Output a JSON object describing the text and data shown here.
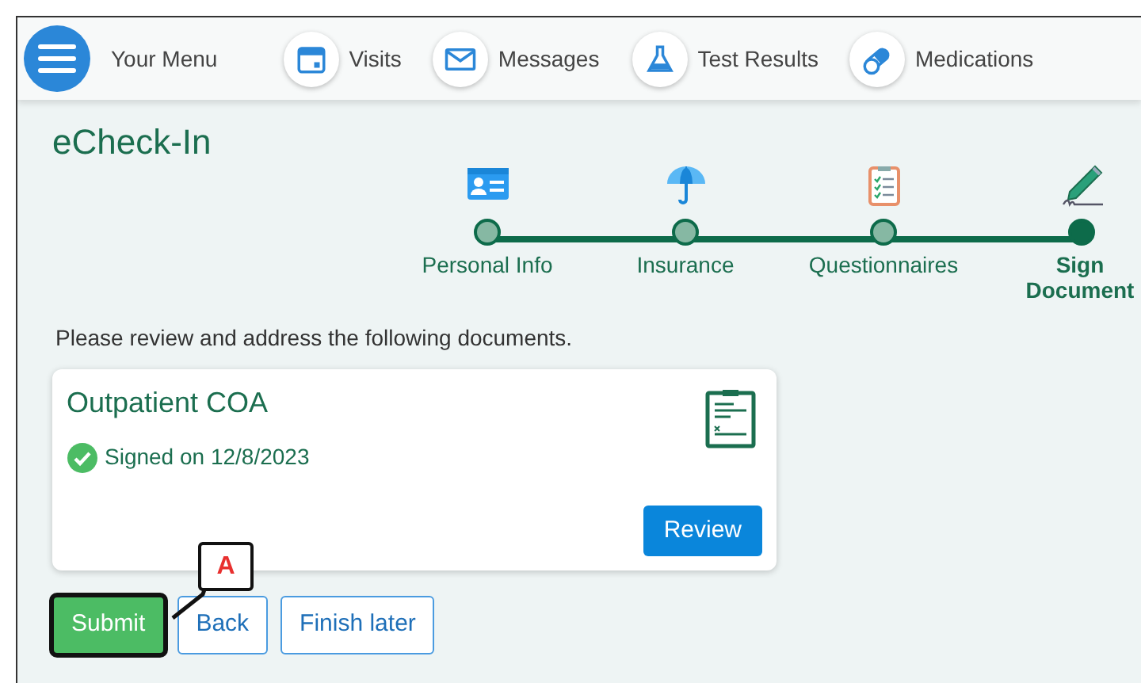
{
  "nav": {
    "menu_label": "Your Menu",
    "items": [
      {
        "kind": "calendar",
        "label": "Visits"
      },
      {
        "kind": "envelope",
        "label": "Messages"
      },
      {
        "kind": "flask",
        "label": "Test Results"
      },
      {
        "kind": "pills",
        "label": "Medications"
      }
    ]
  },
  "title": "eCheck-In",
  "steps": [
    {
      "kind": "id-card",
      "label": "Personal Info",
      "current": false
    },
    {
      "kind": "umbrella",
      "label": "Insurance",
      "current": false
    },
    {
      "kind": "clipboard",
      "label": "Questionnaires",
      "current": false
    },
    {
      "kind": "pen",
      "label": "Sign Document",
      "current": true
    }
  ],
  "instructions": "Please review and address the following documents.",
  "documents": [
    {
      "title": "Outpatient COA",
      "status": "Signed on 12/8/2023",
      "signed": true,
      "button": "Review"
    }
  ],
  "buttons": [
    {
      "label": "Submit",
      "kind": "primary",
      "highlighted": true
    },
    {
      "label": "Back",
      "kind": "outline",
      "highlighted": false
    },
    {
      "label": "Finish later",
      "kind": "outline",
      "highlighted": false
    }
  ],
  "annotations": [
    {
      "label": "A"
    }
  ]
}
